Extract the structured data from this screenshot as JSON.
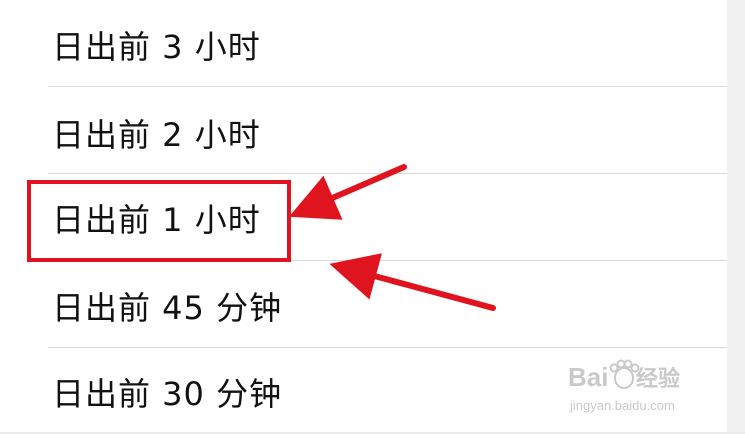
{
  "options": [
    {
      "label": "日出前 3 小时"
    },
    {
      "label": "日出前 2 小时"
    },
    {
      "label": "日出前 1 小时"
    },
    {
      "label": "日出前 45 分钟"
    },
    {
      "label": "日出前 30 分钟"
    }
  ],
  "highlighted_index": 2,
  "annotation_color": "#e0141e",
  "watermark": {
    "brand": "Baidu 经验",
    "url": "jingyan.baidu.com"
  }
}
